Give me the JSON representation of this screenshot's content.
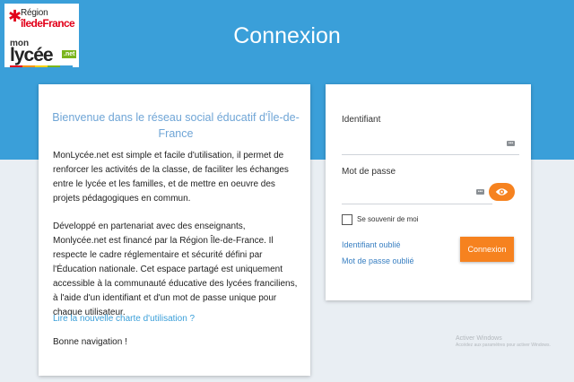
{
  "header": {
    "title": "Connexion",
    "logo": {
      "region_line1": "Région",
      "region_line2": "îledeFrance",
      "mon": "mon",
      "lycee": "lycée",
      "net": ".net"
    }
  },
  "info": {
    "welcome": "Bienvenue dans le réseau social éducatif d'Île-de-France",
    "para1": "MonLycée.net est simple et facile d'utilisation, il permet de renforcer les activités de la classe, de faciliter les échanges entre le lycée et les familles, et de mettre en oeuvre des projets pédagogiques en commun.",
    "para2": "Développé en partenariat avec des enseignants, Monlycée.net est financé par la Région Île-de-France. Il respecte le cadre réglementaire et sécurité défini par l'Éducation nationale. Cet espace partagé est uniquement accessible à la communauté éducative des lycées franciliens, à l'aide d'un identifiant et d'un mot de passe unique pour chaque utilisateur.",
    "charter_link": "Lire la nouvelle charte d'utilisation ?",
    "farewell": "Bonne navigation !"
  },
  "login": {
    "id_label": "Identifiant",
    "id_value": "",
    "pw_label": "Mot de passe",
    "pw_value": "",
    "remember_label": "Se souvenir de moi",
    "forgot_id": "Identifiant oublié",
    "forgot_pw": "Mot de passe oublié",
    "submit_label": "Connexion"
  },
  "windows_activation": {
    "title": "Activer Windows",
    "subtitle": "Accédez aux paramètres pour activer Windows."
  },
  "colors": {
    "brand_blue": "#3a9fd9",
    "accent_orange": "#f6821f",
    "region_red": "#e2001a"
  }
}
